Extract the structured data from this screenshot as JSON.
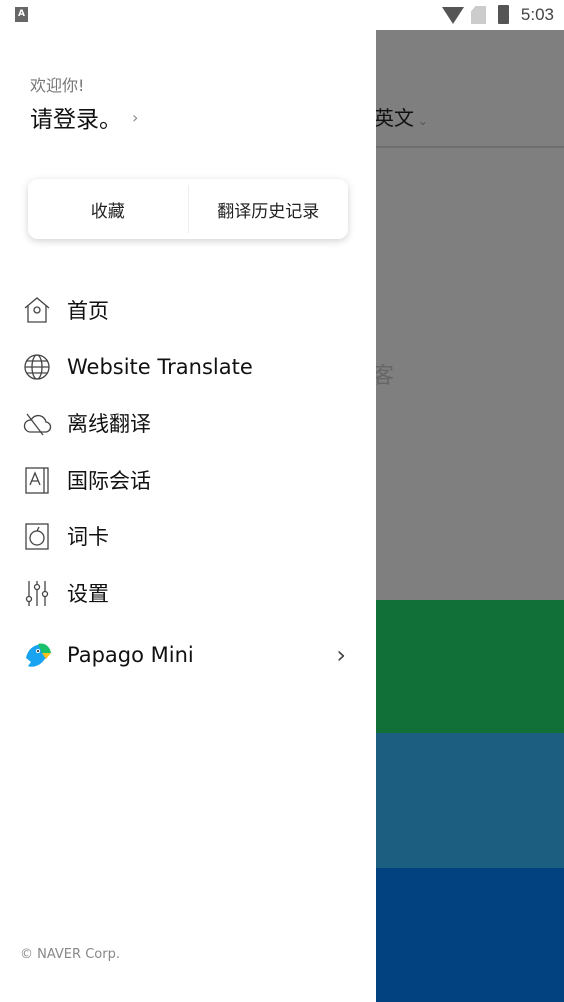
{
  "status_bar": {
    "time": "5:03",
    "notification_icon": "A"
  },
  "background": {
    "language": "英文",
    "faint_text": "客",
    "bands": [
      "#117038",
      "#1b5e80",
      "#024281"
    ]
  },
  "drawer": {
    "welcome": "欢迎你!",
    "login": "请登录。",
    "tabs": {
      "favorites": "收藏",
      "history": "翻译历史记录"
    },
    "menu": [
      {
        "label": "首页",
        "icon": "home-icon"
      },
      {
        "label": "Website Translate",
        "icon": "globe-icon"
      },
      {
        "label": "离线翻译",
        "icon": "cloud-off-icon"
      },
      {
        "label": "国际会话",
        "icon": "phrasebook-icon"
      },
      {
        "label": "词卡",
        "icon": "wordcard-icon"
      },
      {
        "label": "设置",
        "icon": "sliders-icon"
      },
      {
        "label": "Papago Mini",
        "icon": "papago-parrot-icon"
      }
    ],
    "copyright": "© NAVER Corp."
  }
}
